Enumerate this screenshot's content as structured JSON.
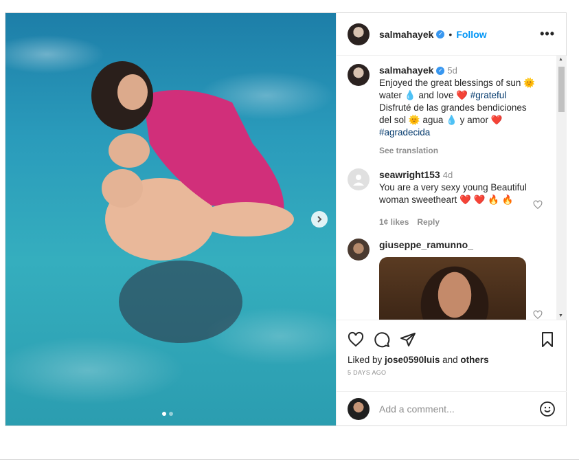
{
  "post": {
    "username": "salmahayek",
    "follow_label": "Follow",
    "separator": "•",
    "more_label": "•••",
    "caption": {
      "username": "salmahayek",
      "time": "5d",
      "text_1": "Enjoyed the great blessings of sun 🌞 water 💧 and love ❤️ ",
      "tag_1": "#grateful",
      "text_2": "Disfruté de las grandes bendiciones del sol 🌞 agua 💧 y amor ❤️ ",
      "tag_2": "#agradecida",
      "see_translation": "See translation"
    },
    "comments": [
      {
        "username": "seawright153",
        "time": "4d",
        "text": "You are a very sexy young Beautiful woman sweetheart ❤️ ❤️ 🔥 🔥",
        "likes": "1¢ likes",
        "reply": "Reply"
      },
      {
        "username": "giuseppe_ramunno_"
      }
    ],
    "liked_prefix": "Liked by ",
    "liked_user": "jose0590luis",
    "liked_and": " and ",
    "liked_others": "others",
    "time_ago": "5 DAYS AGO",
    "add_comment_placeholder": "Add a comment..."
  },
  "colors": {
    "link_blue": "#0095f6",
    "verified": "#3897f0",
    "hashtag": "#00376b",
    "muted": "#8e8e8e"
  },
  "icons": [
    "verified-badge-icon",
    "more-icon",
    "chevron-right-icon",
    "heart-icon",
    "comment-icon",
    "share-icon",
    "bookmark-icon",
    "emoji-icon",
    "default-avatar-icon"
  ]
}
